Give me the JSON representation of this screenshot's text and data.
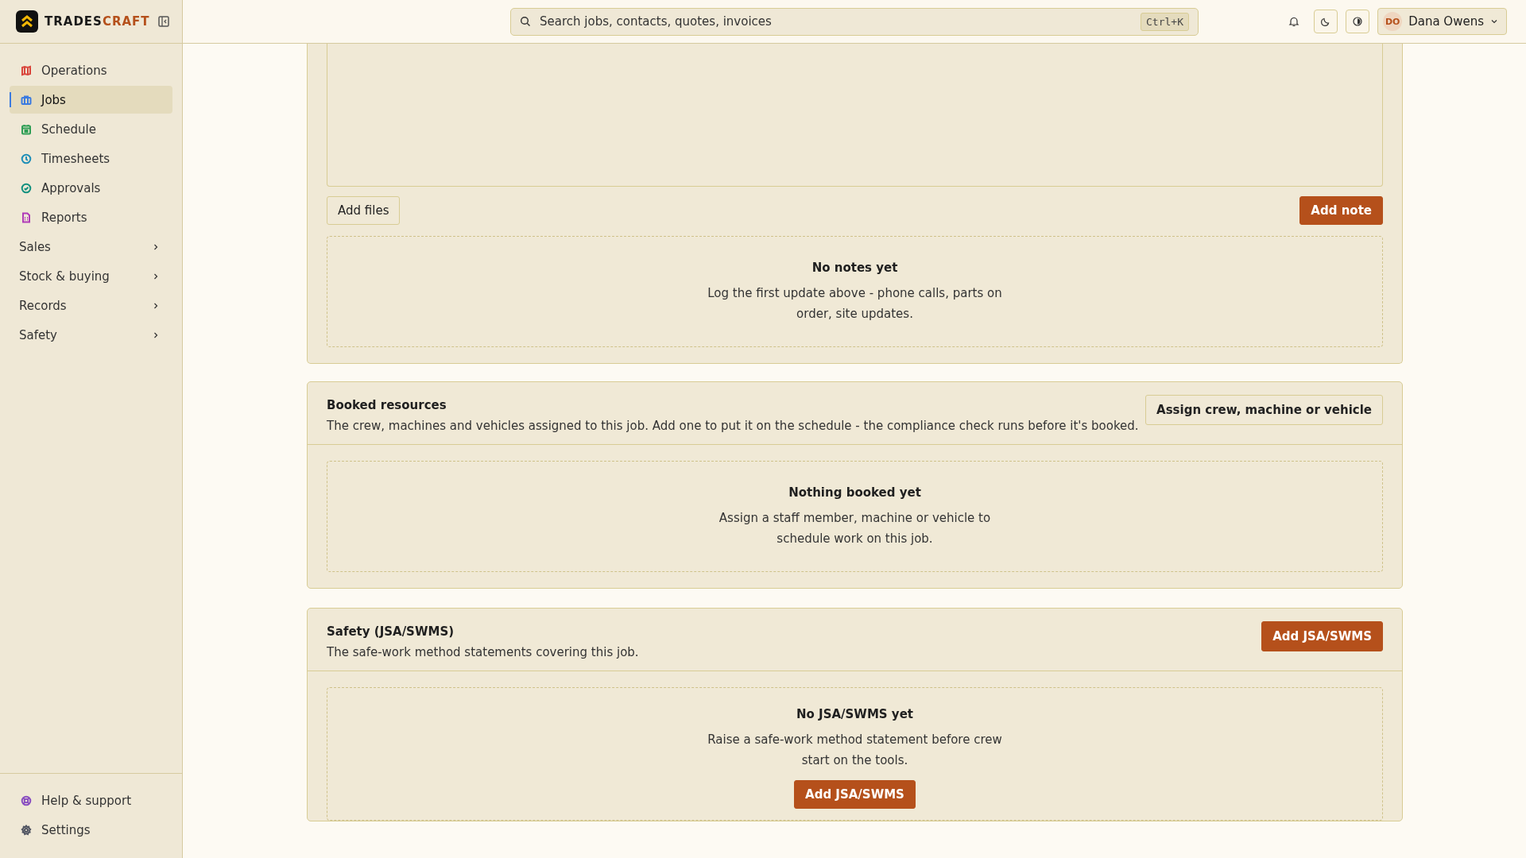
{
  "brand": {
    "name_part_1": "TRADES",
    "name_part_2": "CRAFT"
  },
  "sidebar": {
    "items": [
      {
        "label": "Operations",
        "kind": "link",
        "color": "#d9453b",
        "selected": false
      },
      {
        "label": "Jobs",
        "kind": "link",
        "color": "#3b7be0",
        "selected": true
      },
      {
        "label": "Schedule",
        "kind": "link",
        "color": "#2f9e55",
        "selected": false
      },
      {
        "label": "Timesheets",
        "kind": "link",
        "color": "#1f8fb8",
        "selected": false
      },
      {
        "label": "Approvals",
        "kind": "link",
        "color": "#14917f",
        "selected": false
      },
      {
        "label": "Reports",
        "kind": "link",
        "color": "#b03bb8",
        "selected": false
      },
      {
        "label": "Sales",
        "kind": "group",
        "selected": false
      },
      {
        "label": "Stock & buying",
        "kind": "group",
        "selected": false
      },
      {
        "label": "Records",
        "kind": "group",
        "selected": false
      },
      {
        "label": "Safety",
        "kind": "group",
        "selected": false
      }
    ],
    "footer_items": [
      {
        "label": "Help & support",
        "color": "#8a4fc0"
      },
      {
        "label": "Settings",
        "color": "#4f5360"
      }
    ]
  },
  "header": {
    "search": {
      "placeholder": "Search jobs, contacts, quotes, invoices",
      "shortcut": "Ctrl+K"
    },
    "user": {
      "initials": "DO",
      "name": "Dana Owens"
    }
  },
  "notes": {
    "buttons": [
      {
        "label": "Add files",
        "primary": false
      },
      {
        "label": "Add note",
        "primary": true
      }
    ],
    "empty": {
      "title": "No notes yet",
      "text": "Log the first update above - phone calls, parts on order, site updates."
    }
  },
  "sections": [
    {
      "title": "Booked resources",
      "description": "The crew, machines and vehicles assigned to this job. Add one to put it on the schedule - the compliance check runs before it's booked.",
      "action": {
        "label": "Assign crew, machine or vehicle",
        "primary": false
      },
      "empty": {
        "title": "Nothing booked yet",
        "text": "Assign a staff member, machine or vehicle to schedule work on this job."
      }
    },
    {
      "title": "Safety (JSA/SWMS)",
      "description": "The safe-work method statements covering this job.",
      "action": {
        "label": "Add JSA/SWMS",
        "primary": true
      },
      "empty": {
        "title": "No JSA/SWMS yet",
        "text": "Raise a safe-work method statement before crew start on the tools.",
        "action": {
          "label": "Add JSA/SWMS",
          "primary": true
        }
      }
    }
  ]
}
